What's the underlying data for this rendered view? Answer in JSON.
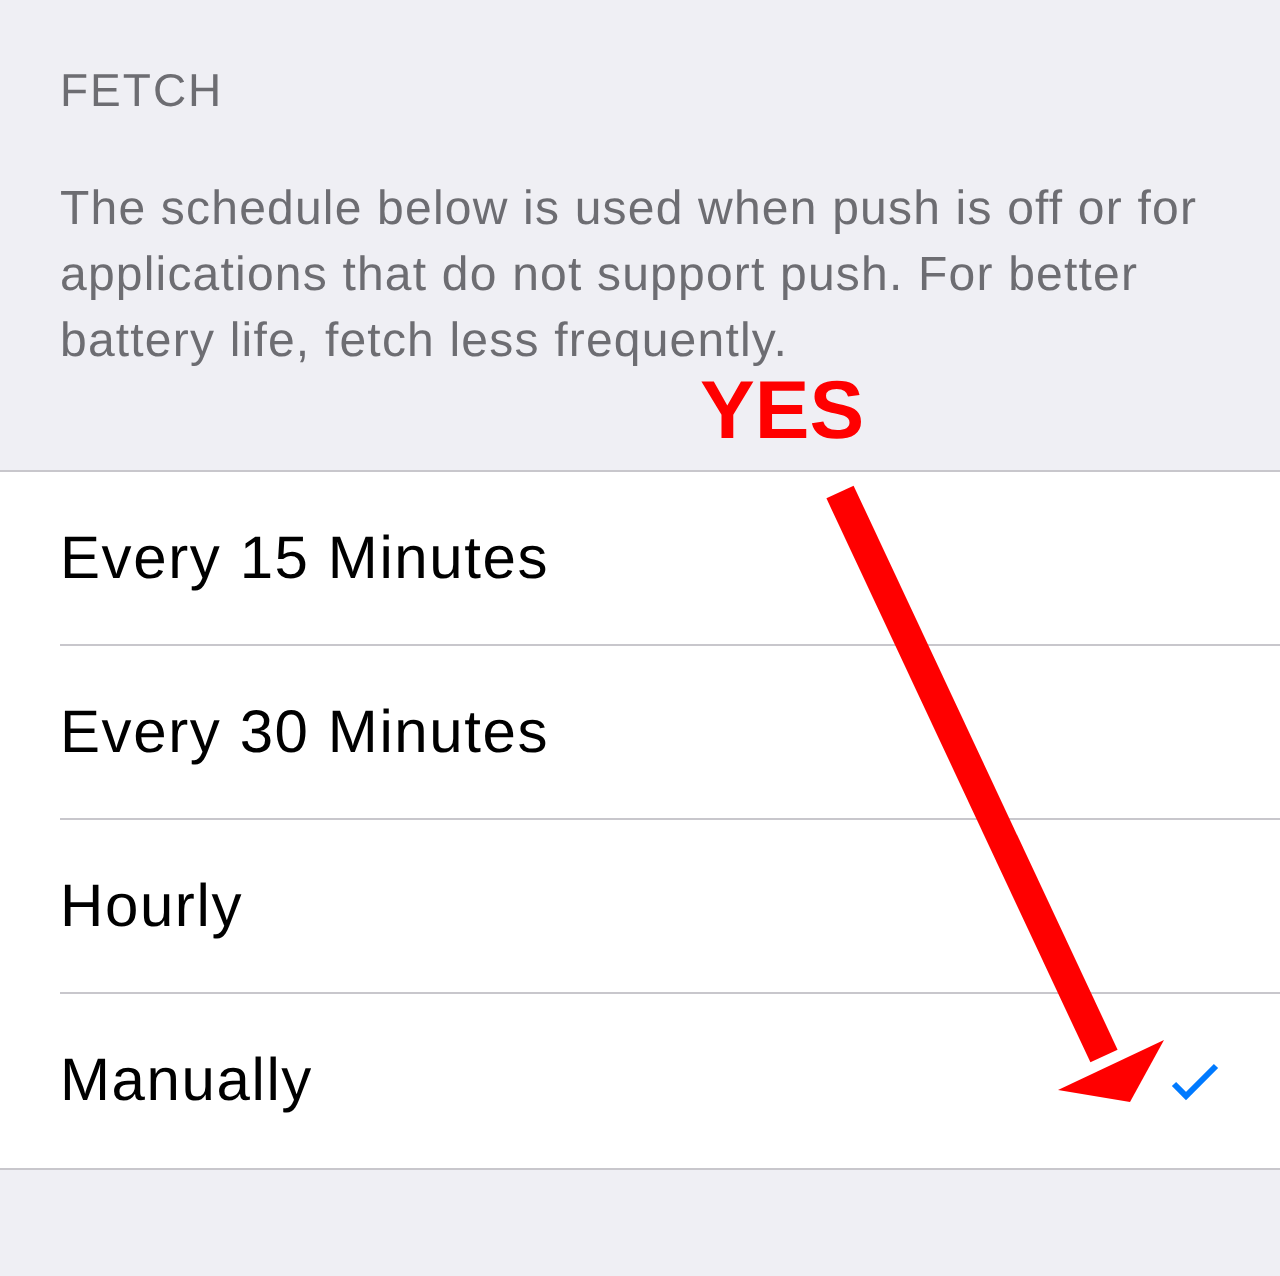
{
  "section": {
    "header": "FETCH",
    "footer": "The schedule below is used when push is off or for applications that do not support push. For better battery life, fetch less frequently."
  },
  "options": [
    {
      "label": "Every 15 Minutes",
      "selected": false
    },
    {
      "label": "Every 30 Minutes",
      "selected": false
    },
    {
      "label": "Hourly",
      "selected": false
    },
    {
      "label": "Manually",
      "selected": true
    }
  ],
  "annotation": {
    "label": "YES"
  }
}
